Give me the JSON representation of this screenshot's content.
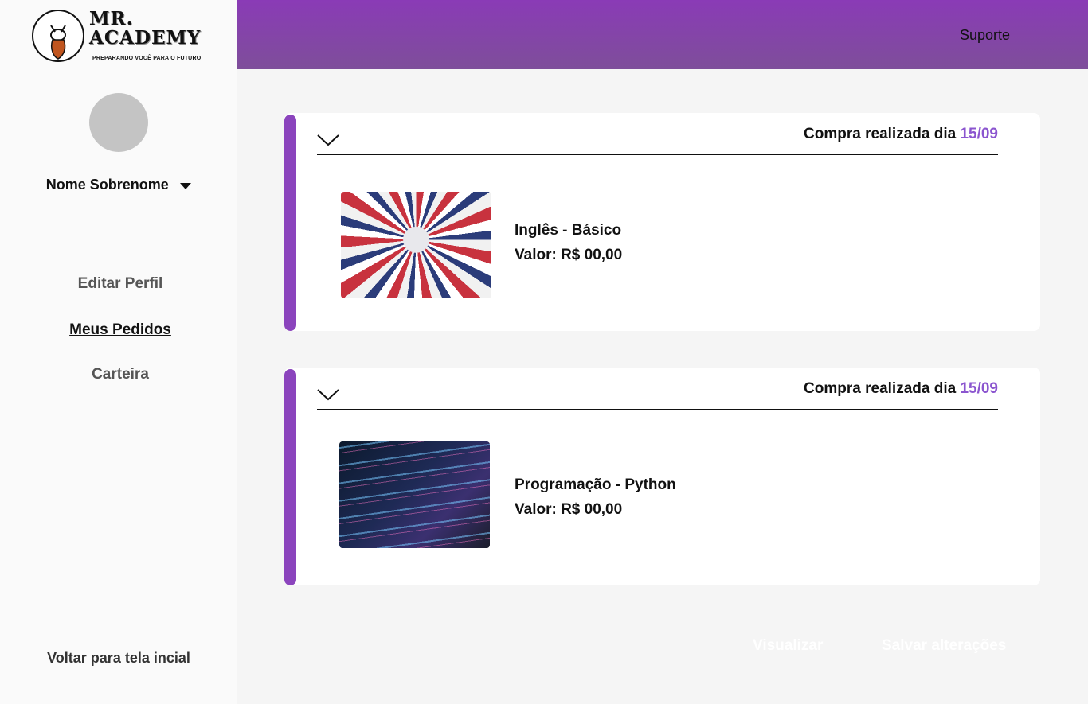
{
  "brand": {
    "title": "MR.\nACADEMY",
    "tagline": "PREPARANDO VOCÊ PARA O FUTURO"
  },
  "header": {
    "support_label": "Suporte",
    "color": "#8a3bb6"
  },
  "sidebar": {
    "user_name": "Nome Sobrenome",
    "items": [
      {
        "label": "Editar Perfil",
        "active": false
      },
      {
        "label": "Meus Pedidos",
        "active": true
      },
      {
        "label": "Carteira",
        "active": false
      }
    ],
    "back_label": "Voltar para tela incial"
  },
  "orders": [
    {
      "purchase_prefix": "Compra realizada dia",
      "date": "15/09",
      "course": "Inglês - Básico",
      "price": "Valor: R$ 00,00",
      "thumbnail": "flags-image"
    },
    {
      "purchase_prefix": "Compra realizada dia",
      "date": "15/09",
      "course": "Programação - Python",
      "price": "Valor: R$ 00,00",
      "thumbnail": "code-image"
    }
  ],
  "footer": {
    "view_label": "Visualizar",
    "save_label": "Salvar alterações"
  },
  "colors": {
    "accent": "#8b44bd",
    "date": "#8b55cf"
  }
}
